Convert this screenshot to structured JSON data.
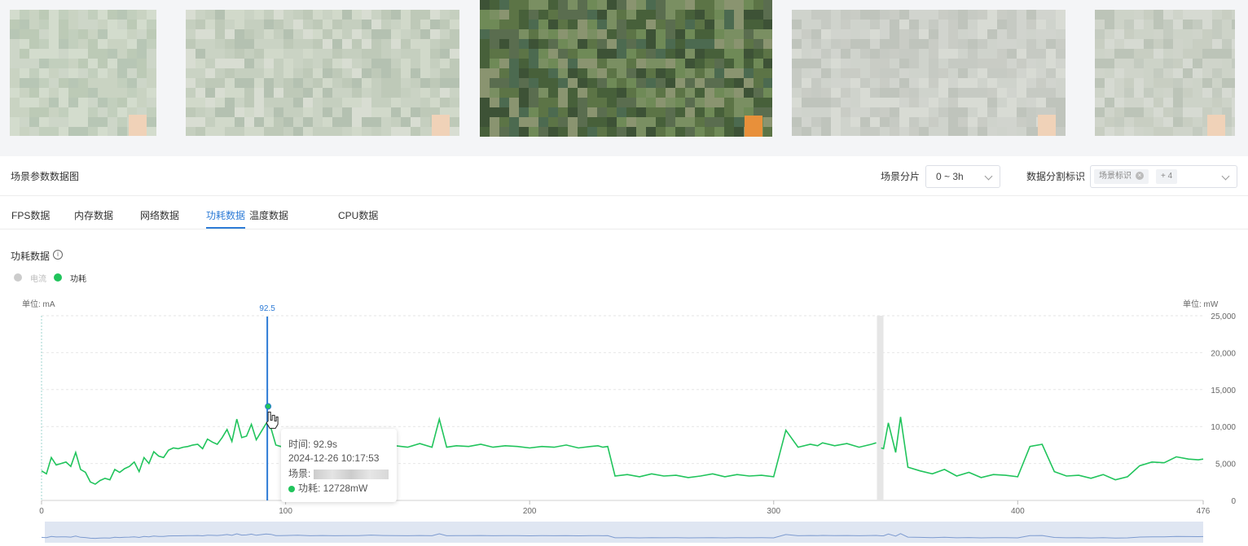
{
  "header": {
    "title": "场景参数数据图",
    "scene_split_label": "场景分片",
    "scene_split_value": "0 ~ 3h",
    "data_split_label": "数据分割标识",
    "data_split_tag": "场景标识",
    "data_split_more": "+ 4"
  },
  "tabs": [
    {
      "label": "FPS数据",
      "active": false
    },
    {
      "label": "内存数据",
      "active": false
    },
    {
      "label": "网络数据",
      "active": false
    },
    {
      "label": "功耗数据",
      "active": true
    },
    {
      "label": "温度数据",
      "active": false
    },
    {
      "label": "CPU数据",
      "active": false
    }
  ],
  "chart": {
    "title": "功耗数据",
    "legend": [
      {
        "name": "电流",
        "enabled": false,
        "color": "#cccccc"
      },
      {
        "name": "功耗",
        "enabled": true,
        "color": "#21c45c"
      }
    ],
    "left_unit": "单位: mA",
    "right_unit": "单位: mW",
    "marker_label": "92.5"
  },
  "tooltip": {
    "time": "时间: 92.9s",
    "datetime": "2024-12-26 10:17:53",
    "scene_label": "场景:",
    "power": "功耗: 12728mW"
  },
  "chart_data": {
    "type": "line",
    "xlabel": "",
    "ylabel": "单位: mW",
    "xlim": [
      0,
      476
    ],
    "ylim": [
      0,
      25000
    ],
    "x_ticks": [
      0,
      100,
      200,
      300,
      400,
      476
    ],
    "y_ticks": [
      0,
      5000,
      10000,
      15000,
      20000,
      25000
    ],
    "y_tick_labels": [
      "0",
      "5,000",
      "10,000",
      "15,000",
      "20,000",
      "25,000"
    ],
    "grid": true,
    "legend_position": "top-left",
    "cursor_x": 92.5,
    "series": [
      {
        "name": "功耗",
        "color": "#21c45c",
        "x": [
          0,
          2,
          4,
          6,
          8,
          10,
          12,
          14,
          16,
          18,
          20,
          22,
          24,
          26,
          28,
          30,
          32,
          34,
          36,
          38,
          40,
          42,
          44,
          46,
          48,
          50,
          52,
          54,
          56,
          58,
          60,
          62,
          64,
          66,
          68,
          70,
          72,
          74,
          76,
          78,
          80,
          82,
          84,
          86,
          88,
          90,
          92,
          94,
          96,
          98,
          100,
          105,
          110,
          115,
          120,
          125,
          130,
          135,
          140,
          145,
          150,
          155,
          160,
          163,
          166,
          170,
          175,
          180,
          185,
          190,
          195,
          200,
          205,
          210,
          215,
          220,
          225,
          228,
          230,
          232,
          235,
          240,
          245,
          250,
          255,
          260,
          265,
          270,
          275,
          280,
          285,
          290,
          295,
          300,
          305,
          310,
          315,
          318,
          320,
          325,
          330,
          335,
          340,
          342,
          344,
          345,
          347,
          350,
          352,
          355,
          360,
          365,
          370,
          375,
          380,
          385,
          390,
          395,
          400,
          405,
          410,
          415,
          420,
          425,
          430,
          435,
          440,
          445,
          450,
          455,
          460,
          465,
          470,
          474,
          476
        ],
        "values": [
          4000,
          3600,
          5800,
          4800,
          5000,
          5200,
          4600,
          6500,
          4200,
          3800,
          2500,
          2200,
          2700,
          3000,
          2800,
          4200,
          3800,
          4300,
          4600,
          5200,
          3900,
          5800,
          5000,
          6600,
          6000,
          5800,
          6800,
          7100,
          7000,
          7200,
          7300,
          7500,
          7600,
          7000,
          8300,
          7900,
          7600,
          8500,
          9600,
          8000,
          11000,
          8500,
          8700,
          10300,
          8200,
          9300,
          10400,
          9800,
          7500,
          7300,
          7700,
          8100,
          7200,
          7600,
          7200,
          7300,
          7500,
          8400,
          7600,
          7400,
          7200,
          7700,
          7200,
          11000,
          7200,
          7400,
          7300,
          7600,
          7200,
          7400,
          7300,
          7100,
          7300,
          7200,
          7500,
          7100,
          7300,
          7400,
          7200,
          7300,
          3300,
          3500,
          3200,
          3600,
          3300,
          3400,
          3100,
          3300,
          3600,
          3200,
          3500,
          3300,
          3400,
          3200,
          9500,
          7200,
          7600,
          7400,
          7800,
          7400,
          7700,
          7200,
          7600,
          7800,
          7100,
          7000,
          10500,
          6500,
          11300,
          4500,
          4000,
          3600,
          4200,
          3300,
          3800,
          3100,
          3500,
          3400,
          3200,
          7300,
          7600,
          3900,
          3300,
          3400,
          3000,
          3500,
          2800,
          3200,
          4700,
          5200,
          5100,
          5900,
          5600,
          5500,
          5600
        ]
      }
    ]
  }
}
